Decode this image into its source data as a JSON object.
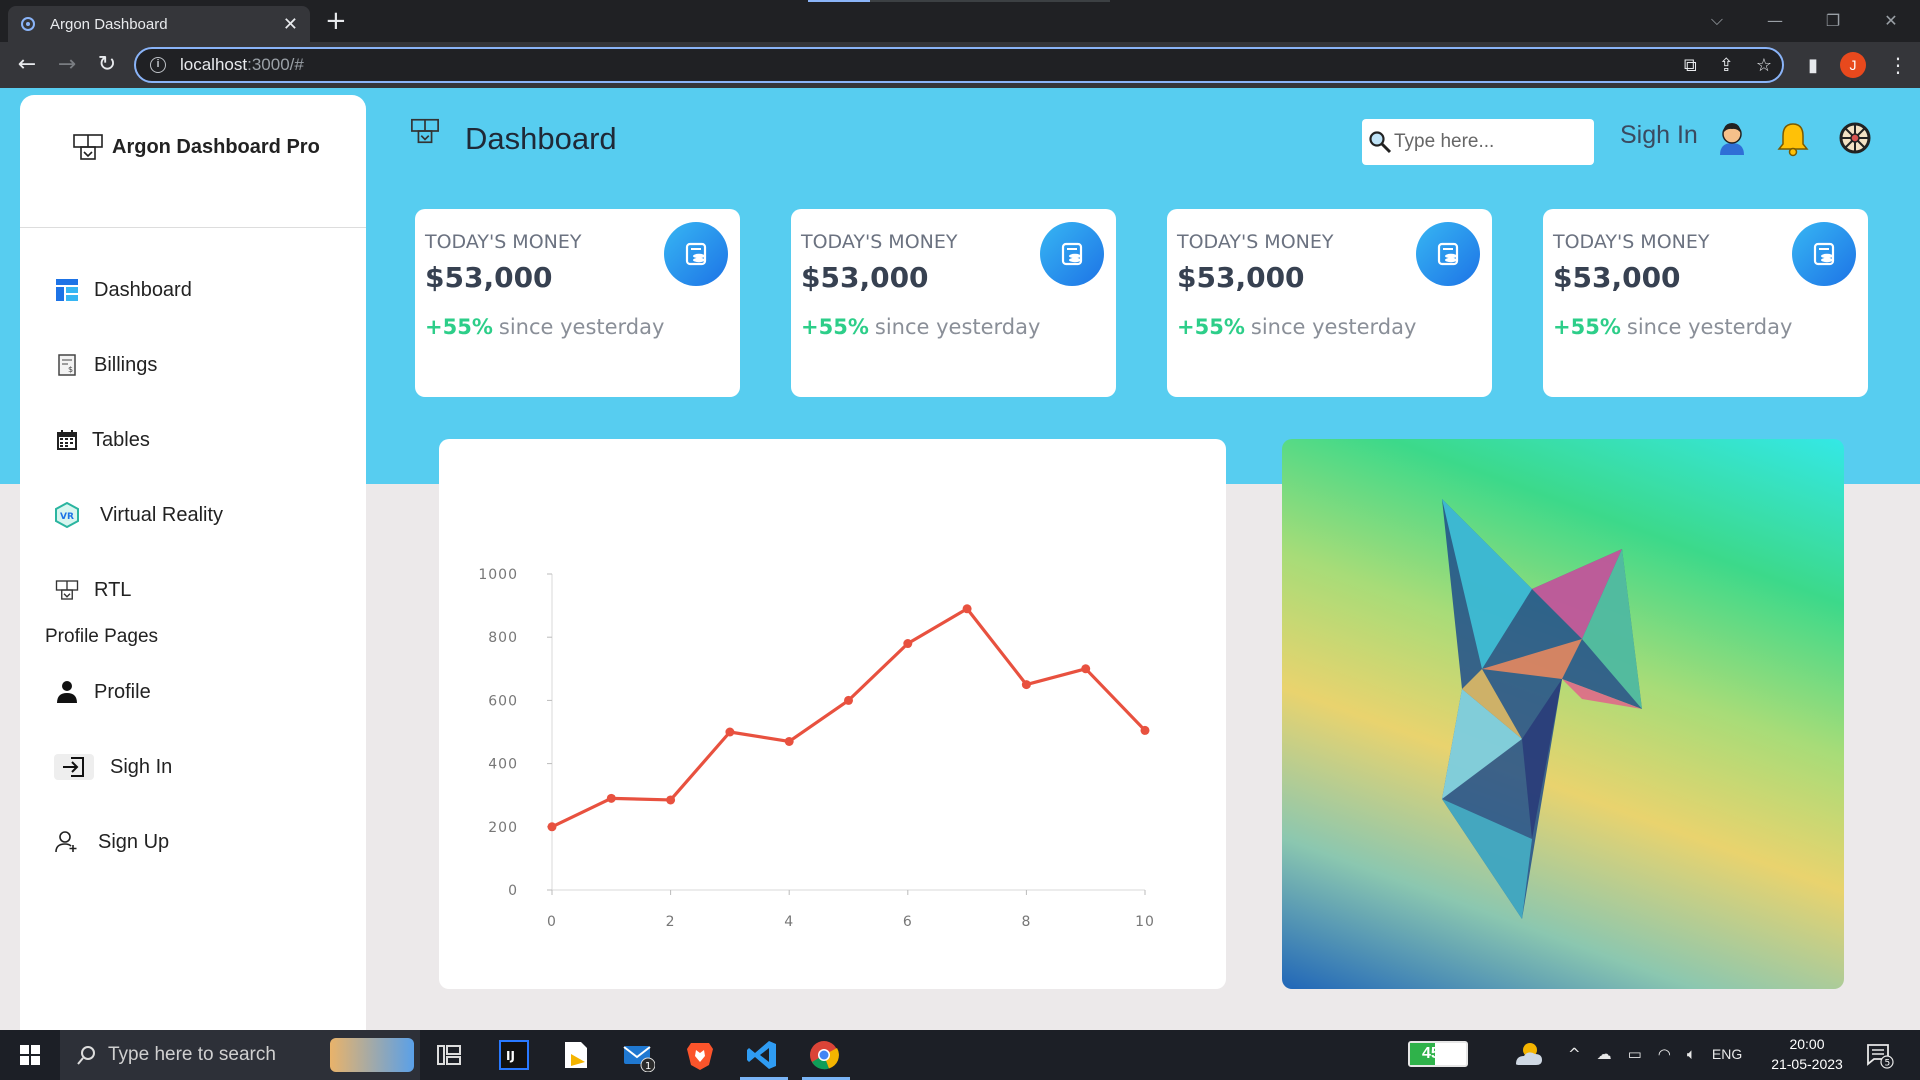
{
  "browser": {
    "tab_title": "Argon Dashboard",
    "tab_close": "✕",
    "new_tab": "+",
    "url_host": "localhost",
    "url_path": ":3000/#",
    "profile_initial": "J",
    "window_controls": [
      "⌵",
      "—",
      "❐",
      "✕"
    ]
  },
  "sidebar": {
    "brand": "Argon Dashboard Pro",
    "items": [
      {
        "label": "Dashboard",
        "icon": "dashboard-icon"
      },
      {
        "label": "Billings",
        "icon": "billing-icon"
      },
      {
        "label": "Tables",
        "icon": "calendar-icon"
      },
      {
        "label": "Virtual Reality",
        "icon": "vr-icon"
      },
      {
        "label": "RTL",
        "icon": "rtl-icon"
      }
    ],
    "section_label": "Profile Pages",
    "profile_items": [
      {
        "label": "Profile",
        "icon": "user-icon"
      },
      {
        "label": "Sigh In",
        "icon": "sign-in-icon"
      },
      {
        "label": "Sign Up",
        "icon": "add-user-icon"
      }
    ]
  },
  "header": {
    "title": "Dashboard",
    "search_placeholder": "Type here...",
    "signin_label": "Sigh In"
  },
  "stats": [
    {
      "label": "TODAY'S MONEY",
      "value": "$53,000",
      "change": "+55%",
      "change_text": "since yesterday"
    },
    {
      "label": "TODAY'S MONEY",
      "value": "$53,000",
      "change": "+55%",
      "change_text": "since yesterday"
    },
    {
      "label": "TODAY'S MONEY",
      "value": "$53,000",
      "change": "+55%",
      "change_text": "since yesterday"
    },
    {
      "label": "TODAY'S MONEY",
      "value": "$53,000",
      "change": "+55%",
      "change_text": "since yesterday"
    }
  ],
  "chart_data": {
    "type": "line",
    "title": "",
    "xlabel": "",
    "ylabel": "",
    "x": [
      0,
      1,
      2,
      3,
      4,
      5,
      6,
      7,
      8,
      9,
      10
    ],
    "series": [
      {
        "values": [
          200,
          290,
          285,
          500,
          470,
          600,
          780,
          890,
          650,
          700,
          505
        ],
        "color": "#e8513f"
      }
    ],
    "xlim": [
      0,
      10
    ],
    "ylim": [
      0,
      1000
    ],
    "xticks": [
      0,
      2,
      4,
      6,
      8,
      10
    ],
    "yticks": [
      0,
      200,
      400,
      600,
      800,
      1000
    ],
    "grid": false
  },
  "taskbar": {
    "search_placeholder": "Type here to search",
    "battery": "45%",
    "battery_level": 0.45,
    "language": "ENG",
    "time": "20:00",
    "date": "21-05-2023",
    "notifications": "5",
    "mail_badge": "1"
  }
}
